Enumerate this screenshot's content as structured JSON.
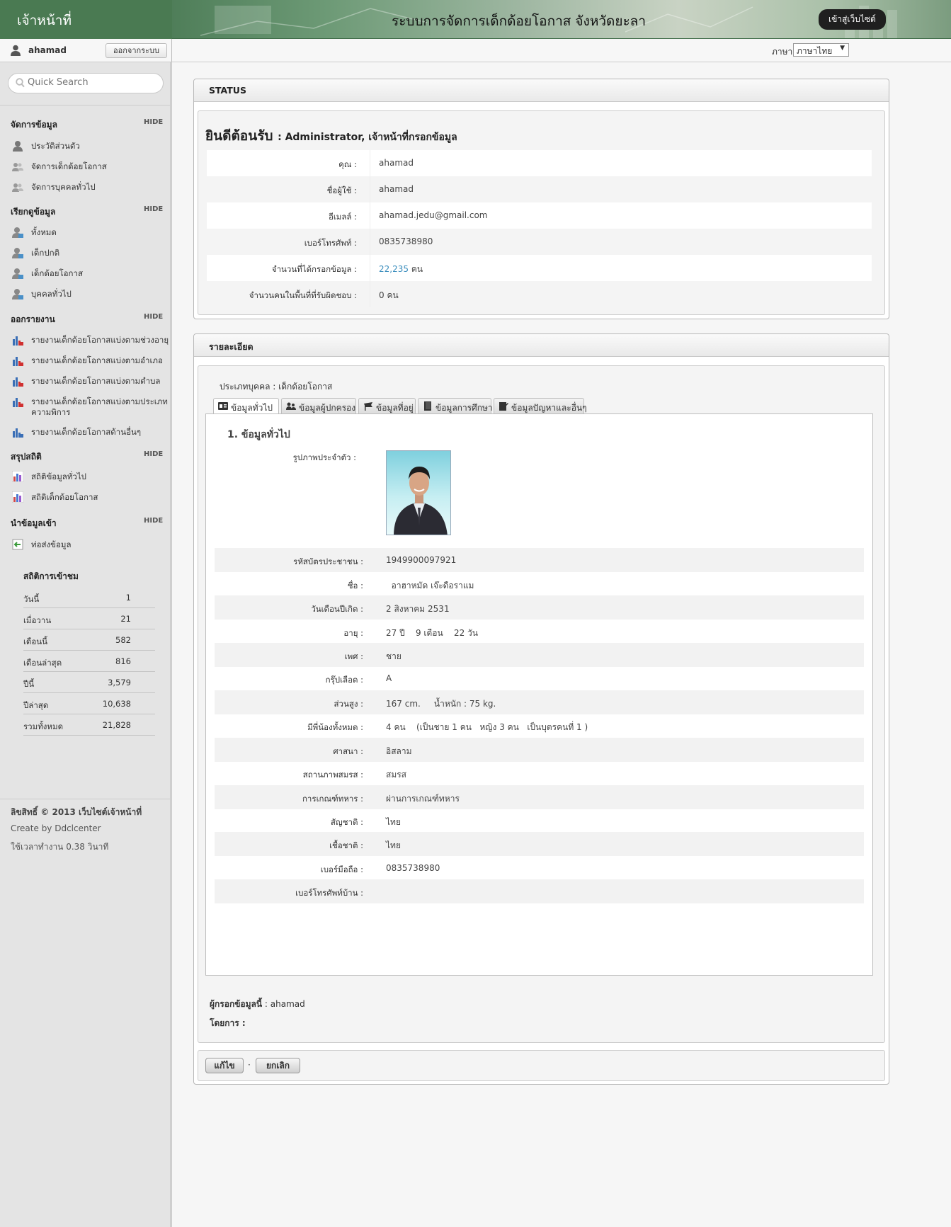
{
  "header": {
    "brand": "เจ้าหน้าที่",
    "title": "ระบบการจัดการเด็กด้อยโอกาส จังหวัดยะลา",
    "website_button": "เข้าสู่เว็บไซต์"
  },
  "user": {
    "name": "ahamad",
    "logout": "ออกจากระบบ"
  },
  "language": {
    "label": "ภาษา",
    "selected": "ภาษาไทย"
  },
  "search": {
    "placeholder": "Quick Search"
  },
  "sidebar": {
    "hide_label": "HIDE",
    "sections": [
      {
        "title": "จัดการข้อมูล",
        "items": [
          "ประวัติส่วนตัว",
          "จัดการเด็กด้อยโอกาส",
          "จัดการบุคคลทั่วไป"
        ]
      },
      {
        "title": "เรียกดูข้อมูล",
        "items": [
          "ทั้งหมด",
          "เด็กปกติ",
          "เด็กด้อยโอกาส",
          "บุคคลทั่วไป"
        ]
      },
      {
        "title": "ออกรายงาน",
        "items": [
          "รายงานเด็กด้อยโอกาสแบ่งตามช่วงอายุ",
          "รายงานเด็กด้อยโอกาสแบ่งตามอำเภอ",
          "รายงานเด็กด้อยโอกาสแบ่งตามตำบล",
          "รายงานเด็กด้อยโอกาสแบ่งตามประเภทความพิการ",
          "รายงานเด็กด้อยโอกาสด้านอื่นๆ"
        ]
      },
      {
        "title": "สรุปสถิติ",
        "items": [
          "สถิติข้อมูลทั่วไป",
          "สถิติเด็กด้อยโอกาส"
        ]
      },
      {
        "title": "นำข้อมูลเข้า",
        "items": [
          "ท่อส่งข้อมูล"
        ]
      }
    ]
  },
  "visitor_stats": {
    "title": "สถิติการเข้าชม",
    "rows": [
      {
        "label": "วันนี้",
        "value": "1"
      },
      {
        "label": "เมื่อวาน",
        "value": "21"
      },
      {
        "label": "เดือนนี้",
        "value": "582"
      },
      {
        "label": "เดือนล่าสุด",
        "value": "816"
      },
      {
        "label": "ปีนี้",
        "value": "3,579"
      },
      {
        "label": "ปีล่าสุด",
        "value": "10,638"
      },
      {
        "label": "รวมทั้งหมด",
        "value": "21,828"
      }
    ]
  },
  "footer": {
    "copyright": "ลิขสิทธิ์ © 2013 เว็บไซต์เจ้าหน้าที่",
    "credit": "Create by Ddclcenter",
    "timing": "ใช้เวลาทำงาน 0.38 วินาที"
  },
  "status_panel": {
    "title": "STATUS",
    "welcome": "ยินดีต้อนรับ",
    "role": ": Administrator, เจ้าหน้าที่กรอกข้อมูล",
    "rows": [
      {
        "label": "คุณ :",
        "value": "ahamad"
      },
      {
        "label": "ชื่อผู้ใช้ :",
        "value": "ahamad"
      },
      {
        "label": "อีเมลล์ :",
        "value": "ahamad.jedu@gmail.com"
      },
      {
        "label": "เบอร์โทรศัพท์ :",
        "value": "0835738980"
      },
      {
        "label": "จำนวนที่ได้กรอกข้อมูล :",
        "value": "22,235",
        "suffix": " คน"
      },
      {
        "label": "จำนวนคนในพื้นที่ที่รับผิดชอบ :",
        "value": "0 คน"
      }
    ]
  },
  "detail_panel": {
    "title": "รายละเอียด",
    "person_type": "ประเภทบุคคล : เด็กด้อยโอกาส",
    "tabs": [
      "ข้อมูลทั่วไป",
      "ข้อมูลผู้ปกครอง",
      "ข้อมูลที่อยู่",
      "ข้อมูลการศึกษา",
      "ข้อมูลปัญหาและอื่นๆ"
    ],
    "section_title": "1. ข้อมูลทั่วไป",
    "photo_label": "รูปภาพประจำตัว :",
    "profile": [
      {
        "label": "รหัสบัตรประชาชน :",
        "value": "1949900097921"
      },
      {
        "label": "ชื่อ :",
        "value": "  อาฮาหมัด เจ๊ะดือราแม"
      },
      {
        "label": "วันเดือนปีเกิด :",
        "value": "2 สิงหาคม 2531"
      },
      {
        "label": "อายุ :",
        "value": "27 ปี    9 เดือน    22 วัน"
      },
      {
        "label": "เพศ :",
        "value": "ชาย"
      },
      {
        "label": "กรุ๊ปเลือด :",
        "value": "A"
      },
      {
        "label": "ส่วนสูง :",
        "value": "167 cm.     น้ำหนัก : 75 kg."
      },
      {
        "label": "มีพี่น้องทั้งหมด :",
        "value": "4 คน    (เป็นชาย 1 คน   หญิง 3 คน   เป็นบุตรคนที่ 1 )"
      },
      {
        "label": "ศาสนา :",
        "value": "อิสลาม"
      },
      {
        "label": "สถานภาพสมรส :",
        "value": "สมรส"
      },
      {
        "label": "การเกณฑ์ทหาร :",
        "value": "ผ่านการเกณฑ์ทหาร"
      },
      {
        "label": "สัญชาติ :",
        "value": "ไทย"
      },
      {
        "label": "เชื้อชาติ :",
        "value": "ไทย"
      },
      {
        "label": "เบอร์มือถือ :",
        "value": "0835738980"
      },
      {
        "label": "เบอร์โทรศัพท์บ้าน :",
        "value": ""
      }
    ],
    "filled_by_label": "ผู้กรอกข้อมูลนี้",
    "filled_by_value": " : ahamad",
    "by_label": "โดยการ :",
    "edit_button": "แก้ไข",
    "separator": "·",
    "cancel_button": "ยกเลิก"
  }
}
